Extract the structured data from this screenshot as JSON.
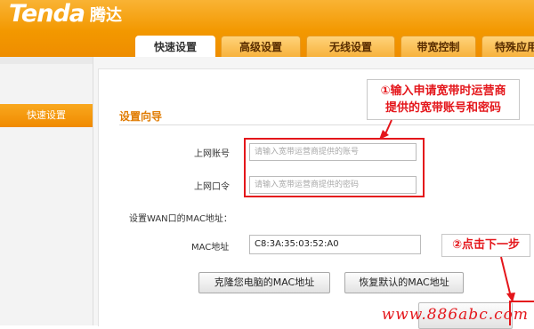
{
  "brand": {
    "name_en": "Tenda",
    "name_cn": "腾达"
  },
  "tabs": [
    {
      "label": "快速设置",
      "active": true
    },
    {
      "label": "高级设置",
      "active": false
    },
    {
      "label": "无线设置",
      "active": false
    },
    {
      "label": "带宽控制",
      "active": false
    },
    {
      "label": "特殊应用",
      "active": false
    }
  ],
  "sidebar": {
    "items": [
      {
        "label": "快速设置",
        "active": true
      }
    ]
  },
  "wizard": {
    "title": "设置向导",
    "account": {
      "label": "上网账号",
      "placeholder": "请输入宽带运营商提供的账号"
    },
    "password": {
      "label": "上网口令",
      "placeholder": "请输入宽带运营商提供的密码"
    },
    "mac_section_label": "设置WAN口的MAC地址：",
    "mac": {
      "label": "MAC地址",
      "value": "C8:3A:35:03:52:A0"
    },
    "clone_button": "克隆您电脑的MAC地址",
    "restore_button": "恢复默认的MAC地址"
  },
  "annotations": {
    "callout1_line1": "①输入申请宽带时运营商",
    "callout1_line2": "提供的宽带账号和密码",
    "callout2": "②点击下一步",
    "watermark": "www.886abc.com"
  },
  "colors": {
    "brand_orange": "#f39800",
    "annotation_red": "#e4161b",
    "title_orange": "#e07b00"
  }
}
